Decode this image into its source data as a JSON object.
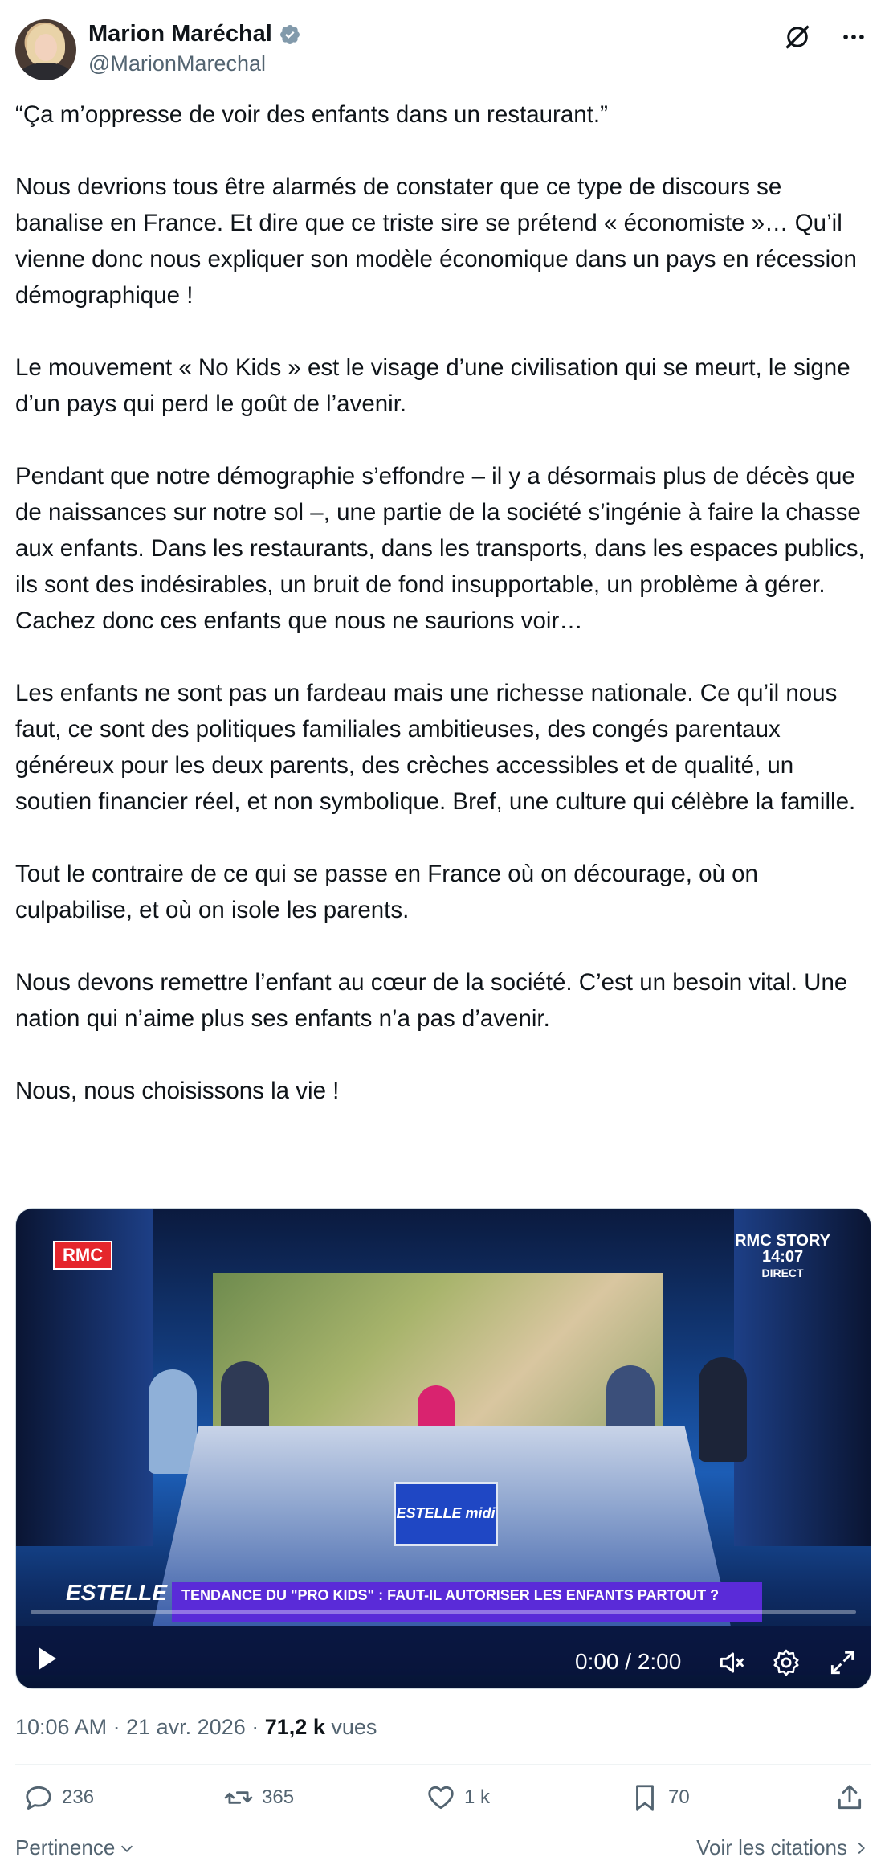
{
  "author": {
    "display_name": "Marion Maréchal",
    "handle": "@MarionMarechal",
    "verified_icon": "verified-badge-icon",
    "accent_color": "#1d9bf0"
  },
  "header_icons": [
    "grok-icon",
    "more-icon"
  ],
  "tweet": {
    "text": "“Ça m’oppresse de voir des enfants dans un restaurant.”\n\nNous devrions tous être alarmés de constater que ce type de discours se banalise en France. Et dire que ce triste sire se prétend « économiste »… Qu’il vienne donc nous expliquer son modèle économique dans un pays en récession démographique !\n\nLe mouvement « No Kids » est le visage d’une civilisation qui se meurt, le signe d’un pays qui perd le goût de l’avenir.\n\nPendant que notre démographie s’effondre – il y a désormais plus de décès que de naissances sur notre sol –, une partie de la société s’ingénie à faire la chasse aux enfants. Dans les restaurants, dans les transports, dans les espaces publics, ils sont des indésirables, un bruit de fond insupportable, un problème à gérer. Cachez donc ces enfants que nous ne saurions voir…\n\nLes enfants ne sont pas un fardeau mais une richesse nationale. Ce qu’il nous faut, ce sont des politiques familiales ambitieuses, des congés parentaux généreux pour les deux parents, des crèches accessibles et de qualité, un soutien financier réel, et non symbolique. Bref, une culture qui célèbre la famille.\n\nTout le contraire de ce qui se passe en France où on décourage, où on culpabilise, et où on isole les parents.\n\nNous devons remettre l’enfant au cœur de la société. C’est un besoin vital. Une nation qui n’aime plus ses enfants n’a pas d’avenir.\n\nNous, nous choisissons la vie !"
  },
  "video": {
    "channel_logo": "RMC",
    "channel_story": "RMC STORY",
    "clock": "14:07",
    "live_label": "DIRECT",
    "show_name": "ESTELLE midi",
    "desk_logo": "ESTELLE midi",
    "banner_text": "TENDANCE DU \"PRO KIDS\" : FAUT-IL AUTORISER LES ENFANTS PARTOUT ?",
    "time_display": "0:00 / 2:00",
    "progress_fraction": 0.0
  },
  "meta": {
    "time": "10:06 AM",
    "separator": "·",
    "date": "21 avr. 2026",
    "views_count": "71,2 k",
    "views_label": "vues"
  },
  "actions": {
    "replies": "236",
    "reposts": "365",
    "likes": "1 k",
    "bookmarks": "70"
  },
  "footer": {
    "sort_label": "Pertinence",
    "quotes_label": "Voir les citations"
  }
}
